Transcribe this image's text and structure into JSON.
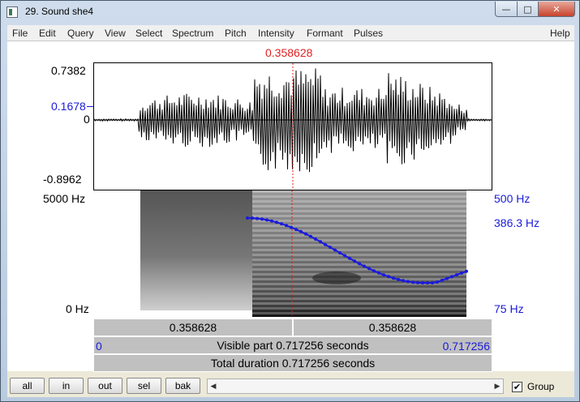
{
  "window": {
    "title": "29. Sound she4",
    "controls": {
      "minimize": "—",
      "maximize": "□",
      "close": "✕"
    }
  },
  "menu": [
    "File",
    "Edit",
    "Query",
    "View",
    "Select",
    "Spectrum",
    "Pitch",
    "Intensity",
    "Formant",
    "Pulses",
    "Help"
  ],
  "cursor_time": "0.358628",
  "waveform": {
    "max_label": "0.7382",
    "value_at_cursor": "0.1678",
    "zero_label": "0",
    "min_label": "-0.8962"
  },
  "spectrogram": {
    "freq_top": "5000 Hz",
    "freq_bottom": "0 Hz",
    "pitch_top": "500 Hz",
    "pitch_at_cursor": "386.3 Hz",
    "pitch_bottom": "75 Hz"
  },
  "bars": {
    "left_segment": "0.358628",
    "right_segment": "0.358628",
    "visible_start": "0",
    "visible_text": "Visible part 0.717256 seconds",
    "visible_end": "0.717256",
    "total_text": "Total duration 0.717256 seconds"
  },
  "toolbar": {
    "buttons": [
      "all",
      "in",
      "out",
      "sel",
      "bak"
    ],
    "group_label": "Group",
    "group_checked": true
  },
  "icons": {
    "scroll_left": "arrow-left-icon",
    "scroll_right": "arrow-right-icon",
    "check": "checkmark-icon"
  }
}
